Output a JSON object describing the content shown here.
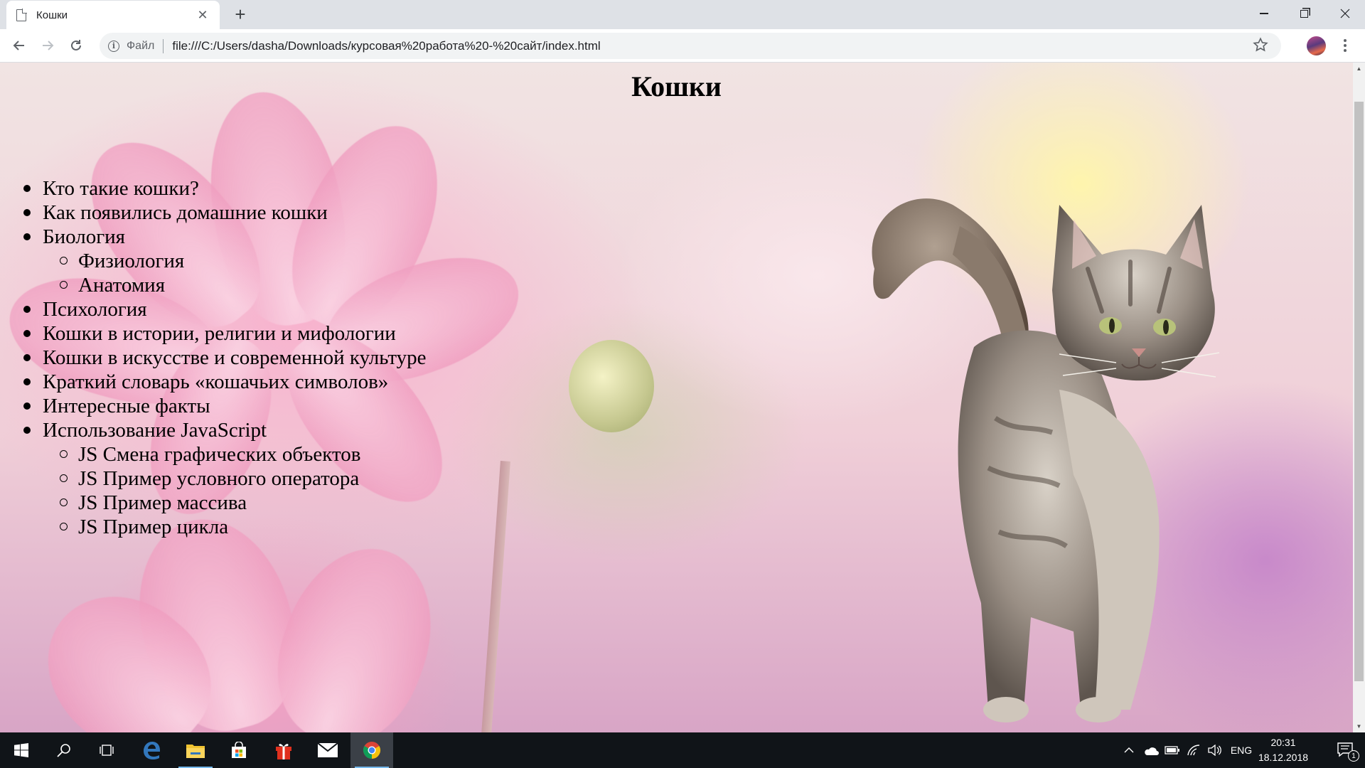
{
  "browser": {
    "tab_title": "Кошки",
    "tab_close": "✕",
    "new_tab": "+",
    "scheme_label": "Файл",
    "url": "file:///C:/Users/dasha/Downloads/курсовая%20работа%20-%20сайт/index.html"
  },
  "page": {
    "title": "Кошки",
    "nav": [
      {
        "label": "Кто такие кошки?"
      },
      {
        "label": "Как появились домашние кошки"
      },
      {
        "label": "Биология",
        "children": [
          "Физиология",
          "Анатомия"
        ]
      },
      {
        "label": "Психология"
      },
      {
        "label": "Кошки в истории, религии и мифологии"
      },
      {
        "label": "Кошки в искусстве и современной культуре"
      },
      {
        "label": "Краткий словарь «кошачьих символов»"
      },
      {
        "label": "Интересные факты"
      },
      {
        "label": "Использование JavaScript",
        "children": [
          "JS Смена графических объектов",
          "JS Пример условного оператора",
          "JS Пример массива",
          "JS Пример цикла"
        ]
      }
    ]
  },
  "taskbar": {
    "lang": "ENG",
    "time": "20:31",
    "date": "18.12.2018",
    "notifications": "1"
  },
  "icons": {
    "back": "arrow-left-icon",
    "forward": "arrow-right-icon",
    "reload": "reload-icon",
    "info": "info-icon",
    "star": "star-icon",
    "menu": "kebab-menu-icon",
    "start": "windows-start-icon",
    "search": "search-icon",
    "taskview": "task-view-icon",
    "edge": "edge-icon",
    "explorer": "file-explorer-icon",
    "store": "store-icon",
    "gift": "gift-icon",
    "mail": "mail-icon",
    "chrome": "chrome-icon"
  },
  "colors": {
    "tabstrip": "#dee1e6",
    "taskbar": "#101418",
    "accent": "#76b9ed"
  }
}
